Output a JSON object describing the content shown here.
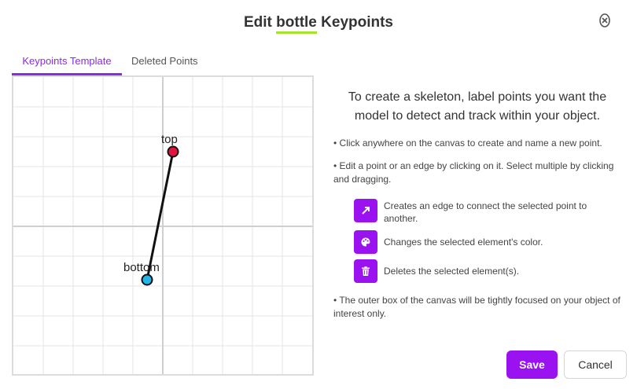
{
  "dialog": {
    "title_prefix": "Edit ",
    "title_highlight": "bottle",
    "title_suffix": " Keypoints",
    "close_icon": "close-circle-icon"
  },
  "tabs": [
    {
      "label": "Keypoints Template",
      "active": true
    },
    {
      "label": "Deleted Points",
      "active": false
    }
  ],
  "canvas": {
    "points": [
      {
        "label": "top",
        "color": "#e0143c"
      },
      {
        "label": "bottom",
        "color": "#22b5e8"
      }
    ],
    "edge_color": "#111111"
  },
  "instructions": {
    "intro": "To create a skeleton, label points you want the model to detect and track within your object.",
    "bullet1": "• Click anywhere on the canvas to create and name a new point.",
    "bullet2": "• Edit a point or an edge by clicking on it. Select multiple by clicking and dragging.",
    "tools": [
      {
        "icon": "arrow-diagonal-icon",
        "text": "Creates an edge to connect the selected point to another."
      },
      {
        "icon": "palette-icon",
        "text": "Changes the selected element's color."
      },
      {
        "icon": "trash-icon",
        "text": "Deletes the selected element(s)."
      }
    ],
    "bullet3": "• The outer box of the canvas will be tightly focused on your object of interest only."
  },
  "footer": {
    "save_label": "Save",
    "cancel_label": "Cancel"
  },
  "colors": {
    "accent": "#9b12f0",
    "title_underline": "#a6e22e"
  }
}
